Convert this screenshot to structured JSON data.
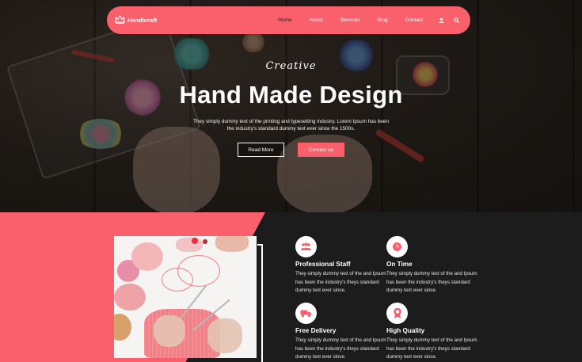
{
  "brand": {
    "name": "Handicraft",
    "icon": "crown-icon"
  },
  "nav": {
    "items": [
      {
        "label": "Home",
        "active": true
      },
      {
        "label": "About",
        "active": false
      },
      {
        "label": "Services",
        "active": false
      },
      {
        "label": "Blog",
        "active": false
      },
      {
        "label": "Contact",
        "active": false
      }
    ],
    "icons": [
      "user-icon",
      "search-icon"
    ]
  },
  "hero": {
    "eyebrow": "Creative",
    "title": "Hand Made Design",
    "subtitle": "They simply dummy text of the printing and typesetting industry. Lorem Ipsum has been the industry's standard dummy text ever since the 1500s.",
    "read_more": "Read More",
    "contact": "Contact us"
  },
  "features": [
    {
      "icon": "people-icon",
      "title": "Professional Staff",
      "text": "They simply dummy text of the and Ipsum has been the industry's theys standard dummy text ever since."
    },
    {
      "icon": "clock-icon",
      "title": "On Time",
      "text": "They simply dummy text of the and Ipsum has been the industry's theys standard dummy text ever since."
    },
    {
      "icon": "truck-icon",
      "title": "Free Delivery",
      "text": "They simply dummy text of the and Ipsum has been the industry's theys standard dummy text ever since."
    },
    {
      "icon": "badge-icon",
      "title": "High Quality",
      "text": "They simply dummy text of the and Ipsum has been the industry's theys standard dummy text ever since."
    }
  ],
  "colors": {
    "accent": "#fa5f6c",
    "dark": "#1c1c1c"
  }
}
